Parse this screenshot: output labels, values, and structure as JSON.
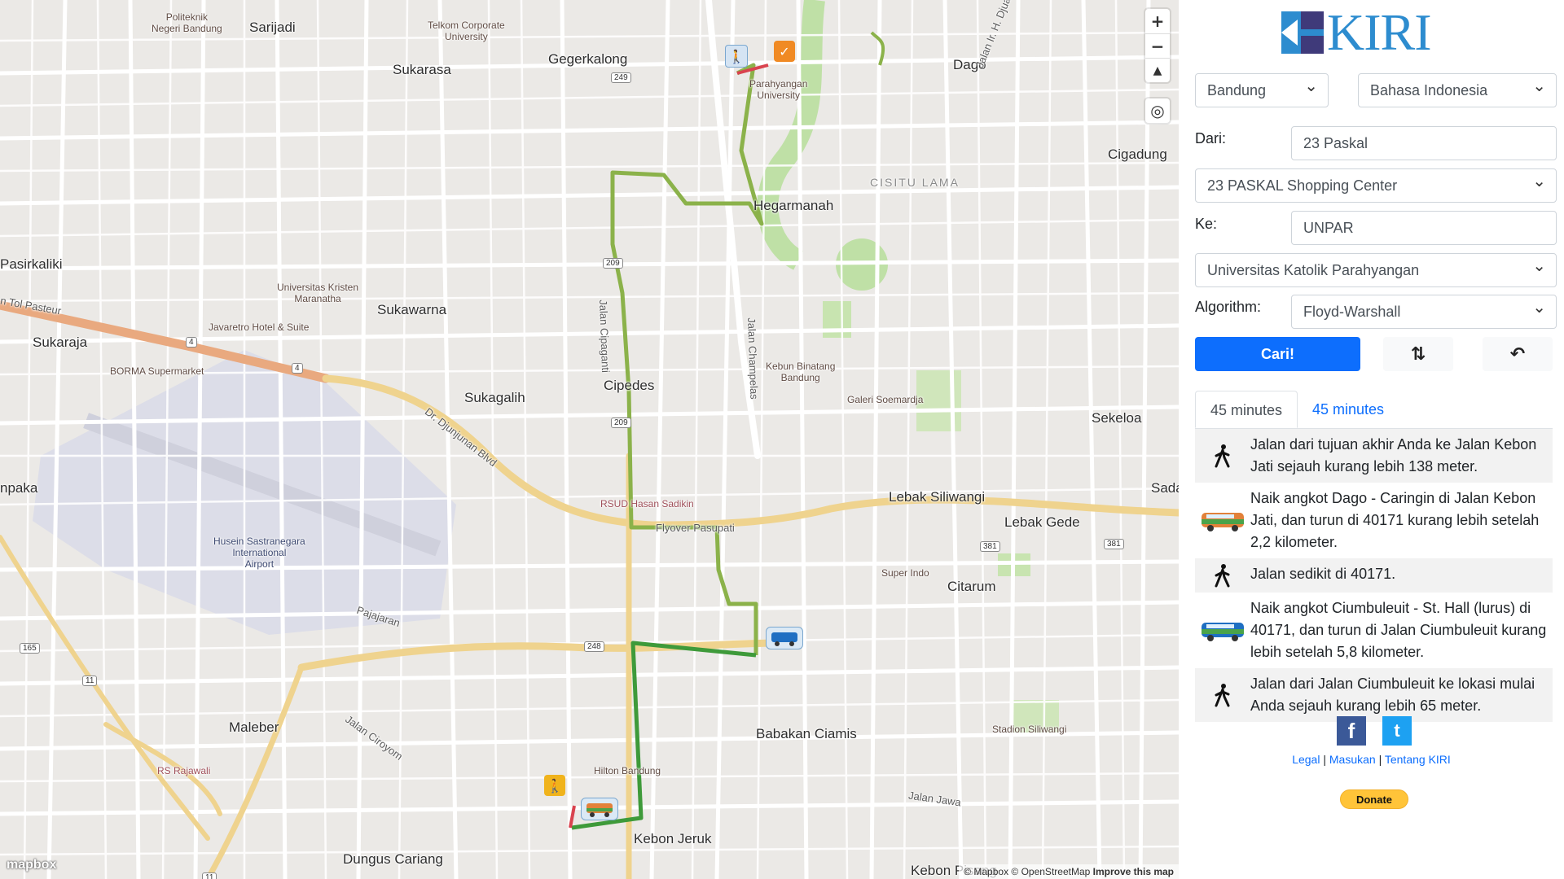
{
  "map": {
    "zoom_in_label": "+",
    "zoom_out_label": "−",
    "compass_label": "▲",
    "locate_label": "◎",
    "attribution": "© Mapbox © OpenStreetMap",
    "improve_label": "Improve this map",
    "mapbox_logo_text": "mapbox",
    "places": [
      {
        "key": "politeknik",
        "text": "Politeknik\nNegeri Bandung"
      },
      {
        "key": "sarijadi",
        "text": "Sarijadi"
      },
      {
        "key": "telkom",
        "text": "Telkom Corporate\nUniversity"
      },
      {
        "key": "sukarasa",
        "text": "Sukarasa"
      },
      {
        "key": "gegerkalong",
        "text": "Gegerkalong"
      },
      {
        "key": "parahyangan",
        "text": "Parahyangan\nUniversity"
      },
      {
        "key": "dago",
        "text": "Dago"
      },
      {
        "key": "jalan_djuanda",
        "text": "Jalan Ir. H. Djuanda"
      },
      {
        "key": "cigadung",
        "text": "Cigadung"
      },
      {
        "key": "cisitu",
        "text": "CISITU LAMA"
      },
      {
        "key": "hegarmanah",
        "text": "Hegarmanah"
      },
      {
        "key": "pasirkaliki",
        "text": "Pasirkaliki"
      },
      {
        "key": "ukm",
        "text": "Universitas Kristen\nMaranatha"
      },
      {
        "key": "sukawarna",
        "text": "Sukawarna"
      },
      {
        "key": "tol_pasteur",
        "text": "n Tol Pasteur"
      },
      {
        "key": "javaretro",
        "text": "Javaretro Hotel & Suite"
      },
      {
        "key": "sukaraja",
        "text": "Sukaraja"
      },
      {
        "key": "borma",
        "text": "BORMA Supermarket"
      },
      {
        "key": "jalan_cipaganti",
        "text": "Jalan Cipaganti"
      },
      {
        "key": "jalan_champelas",
        "text": "Jalan Champelas"
      },
      {
        "key": "kebun_binatang",
        "text": "Kebun Binatang\nBandung"
      },
      {
        "key": "galeri",
        "text": "Galeri Soemardja"
      },
      {
        "key": "cipedes",
        "text": "Cipedes"
      },
      {
        "key": "sukagalih",
        "text": "Sukagalih"
      },
      {
        "key": "djunjunan",
        "text": "Dr. Djunjunan Blvd"
      },
      {
        "key": "sekeloa",
        "text": "Sekeloa"
      },
      {
        "key": "pakapaka",
        "text": "npaka"
      },
      {
        "key": "rsud",
        "text": "RSUD Hasan Sadikin"
      },
      {
        "key": "lebak_siliwangi",
        "text": "Lebak Siliwangi"
      },
      {
        "key": "sada",
        "text": "Sada"
      },
      {
        "key": "lebak_gede",
        "text": "Lebak Gede"
      },
      {
        "key": "flyover",
        "text": "Flyover Pasupati"
      },
      {
        "key": "airport",
        "text": "Husein Sastranegara\nInternational\nAirport"
      },
      {
        "key": "super_indo",
        "text": "Super Indo"
      },
      {
        "key": "citarum",
        "text": "Citarum"
      },
      {
        "key": "pajajaran",
        "text": "Pajajaran"
      },
      {
        "key": "maleber",
        "text": "Maleber"
      },
      {
        "key": "jalan_ciroyom",
        "text": "Jalan Ciroyom"
      },
      {
        "key": "babakan",
        "text": "Babakan Ciamis"
      },
      {
        "key": "stadion",
        "text": "Stadion Siliwangi"
      },
      {
        "key": "rs_rajawali",
        "text": "RS Rajawali"
      },
      {
        "key": "hilton",
        "text": "Hilton Bandung"
      },
      {
        "key": "jalan_jawa",
        "text": "Jalan Jawa"
      },
      {
        "key": "kebon_jeruk",
        "text": "Kebon Jeruk"
      },
      {
        "key": "dungus",
        "text": "Dungus Cariang"
      },
      {
        "key": "kebon_pisang",
        "text": "Kebon Pisang"
      }
    ],
    "shields": [
      "249",
      "209",
      "4",
      "4",
      "209",
      "248",
      "381",
      "381",
      "165",
      "11",
      "11"
    ]
  },
  "sidebar": {
    "logo_text": "KIRI",
    "city_select": "Bandung",
    "language_select": "Bahasa Indonesia",
    "from_label": "Dari:",
    "from_value": "23 Paskal",
    "from_select": "23 PASKAL Shopping Center",
    "to_label": "Ke:",
    "to_value": "UNPAR",
    "to_select": "Universitas Katolik Parahyangan",
    "algorithm_label": "Algorithm:",
    "algorithm_select": "Floyd-Warshall",
    "search_button": "Cari!",
    "swap_button": "⇅",
    "reset_button": "↶",
    "tabs": [
      "45 minutes",
      "45 minutes"
    ],
    "steps": [
      {
        "icon": "walk-icon",
        "text": "Jalan dari tujuan akhir Anda ke Jalan Kebon Jati sejauh kurang lebih 138 meter."
      },
      {
        "icon": "angkot-orange-icon",
        "text": "Naik angkot Dago - Caringin di Jalan Kebon Jati, dan turun di 40171 kurang lebih setelah 2,2 kilometer."
      },
      {
        "icon": "walk-icon",
        "text": "Jalan sedikit di 40171."
      },
      {
        "icon": "angkot-blue-icon",
        "text": "Naik angkot Ciumbuleuit - St. Hall (lurus) di 40171, dan turun di Jalan Ciumbuleuit kurang lebih setelah 5,8 kilometer."
      },
      {
        "icon": "walk-icon",
        "text": "Jalan dari Jalan Ciumbuleuit ke lokasi mulai Anda sejauh kurang lebih 65 meter."
      }
    ],
    "facebook_label": "f",
    "twitter_label": "t",
    "footer": {
      "legal": "Legal",
      "sep1": " | ",
      "masukan": "Masukan",
      "sep2": " | ",
      "tentang": "Tentang KIRI"
    },
    "donate_label": "Donate"
  },
  "colors": {
    "primary": "#0d6efd",
    "route_light_green": "#8bb24a",
    "route_dark_green": "#3e9a3a",
    "logo_blue": "#2d8ccf",
    "logo_purple": "#3f3a7a"
  }
}
